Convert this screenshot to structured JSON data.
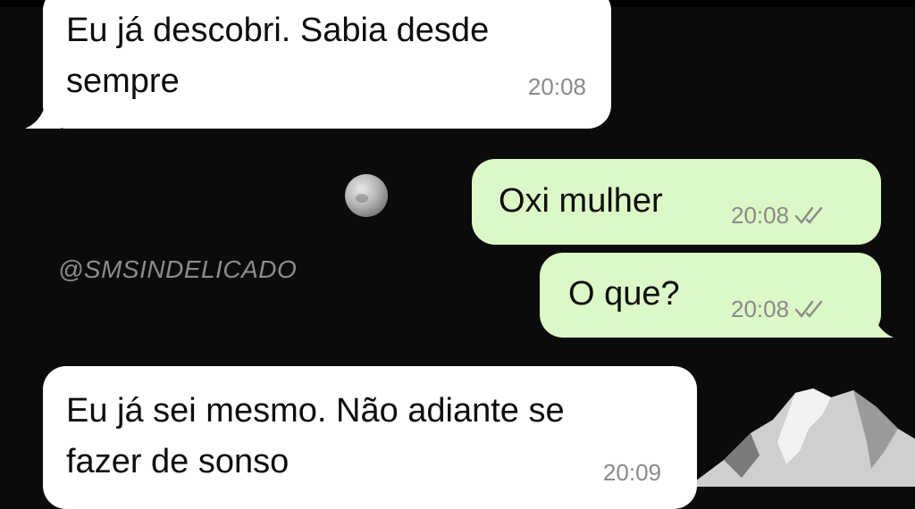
{
  "watermark": "@SMSINDELICADO",
  "colors": {
    "background": "#0b0b0b",
    "incoming_bubble": "#ffffff",
    "outgoing_bubble": "#dcf8c6",
    "time_text": "#8a8a8a"
  },
  "messages": [
    {
      "direction": "incoming",
      "text_line1": "Eu já descobri. Sabia desde",
      "text_line2": "sempre",
      "time": "20:08"
    },
    {
      "direction": "outgoing",
      "text": "Oxi mulher",
      "time": "20:08",
      "status_icon": "double-check-icon"
    },
    {
      "direction": "outgoing",
      "text": "O que?",
      "time": "20:08",
      "status_icon": "double-check-icon"
    },
    {
      "direction": "incoming",
      "text_line1": "Eu já sei mesmo. Não adiante se",
      "text_line2": "fazer de sonso",
      "time": "20:09"
    }
  ]
}
